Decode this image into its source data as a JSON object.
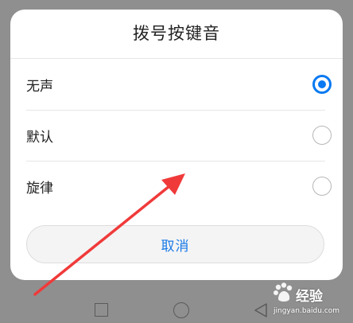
{
  "dialog": {
    "title": "拨号按键音",
    "options": [
      {
        "label": "无声",
        "selected": true
      },
      {
        "label": "默认",
        "selected": false
      },
      {
        "label": "旋律",
        "selected": false
      }
    ],
    "cancel_label": "取消"
  },
  "navigation_bar": {
    "buttons": [
      "recent-apps-icon",
      "home-icon",
      "back-icon"
    ]
  },
  "watermark": {
    "brand": "经验",
    "url": "jingyan.baidu.com"
  },
  "colors": {
    "accent": "#0a79f2",
    "cancel_text": "#1a7ae8",
    "dim_background": "#8f8f8f",
    "annotation_arrow": "#f03a3a"
  }
}
